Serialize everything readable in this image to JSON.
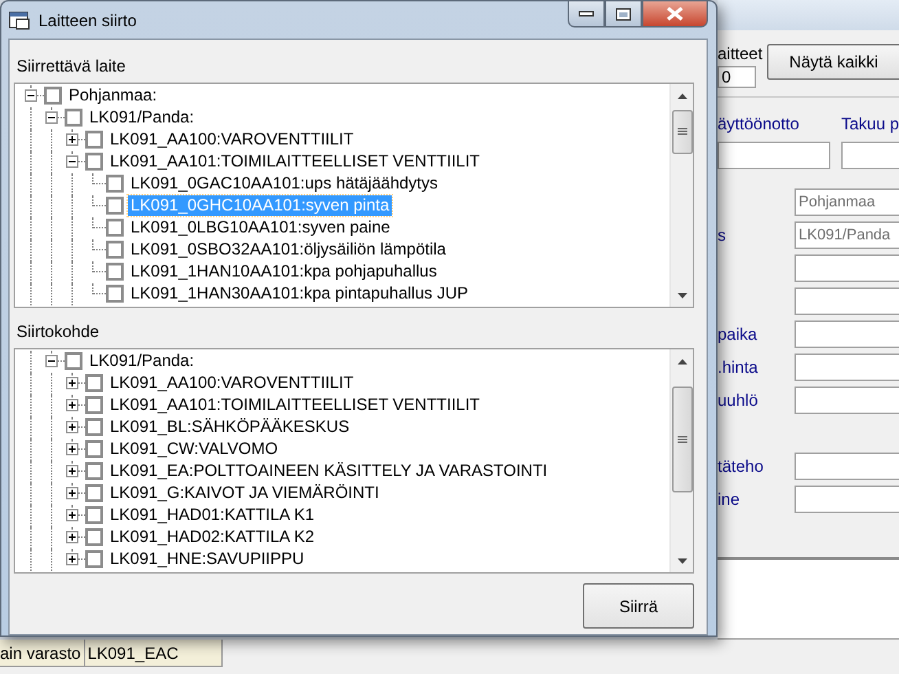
{
  "dialog": {
    "title": "Laitteen siirto",
    "source_label": "Siirrettävä laite",
    "source_tree": [
      {
        "label": "Pohjanmaa:",
        "checked": false,
        "selected": false,
        "expanded": true,
        "children": [
          {
            "label": "LK091/Panda:",
            "checked": false,
            "selected": false,
            "expanded": true,
            "children": [
              {
                "label": "LK091_AA100:VAROVENTTIILIT",
                "checked": false,
                "selected": false,
                "expanded": false
              },
              {
                "label": "LK091_AA101:TOIMILAITTEELLISET VENTTIILIT",
                "checked": false,
                "selected": false,
                "expanded": true,
                "children": [
                  {
                    "label": "LK091_0GAC10AA101:ups hätäjäähdytys",
                    "checked": false,
                    "selected": false
                  },
                  {
                    "label": "LK091_0GHC10AA101:syven pinta",
                    "checked": false,
                    "selected": true
                  },
                  {
                    "label": "LK091_0LBG10AA101:syven paine",
                    "checked": false,
                    "selected": false
                  },
                  {
                    "label": "LK091_0SBO32AA101:öljysäiliön lämpötila",
                    "checked": false,
                    "selected": false
                  },
                  {
                    "label": "LK091_1HAN10AA101:kpa pohjapuhallus",
                    "checked": false,
                    "selected": false
                  },
                  {
                    "label": "LK091_1HAN30AA101:kpa pintapuhallus JUP",
                    "checked": false,
                    "selected": false
                  }
                ]
              }
            ]
          }
        ]
      }
    ],
    "target_label": "Siirtokohde",
    "target_tree": [
      {
        "label": "LK091/Panda:",
        "checked": false,
        "selected": false,
        "expanded": true,
        "children": [
          {
            "label": "LK091_AA100:VAROVENTTIILIT",
            "checked": false,
            "selected": false,
            "expanded": false
          },
          {
            "label": "LK091_AA101:TOIMILAITTEELLISET VENTTIILIT",
            "checked": false,
            "selected": false,
            "expanded": false
          },
          {
            "label": "LK091_BL:SÄHKÖPÄÄKESKUS",
            "checked": false,
            "selected": false,
            "expanded": false
          },
          {
            "label": "LK091_CW:VALVOMO",
            "checked": false,
            "selected": false,
            "expanded": false
          },
          {
            "label": "LK091_EA:POLTTOAINEEN KÄSITTELY JA VARASTOINTI",
            "checked": false,
            "selected": false,
            "expanded": false
          },
          {
            "label": "LK091_G:KAIVOT JA VIEMÄRÖINTI",
            "checked": false,
            "selected": false,
            "expanded": false
          },
          {
            "label": "LK091_HAD01:KATTILA K1",
            "checked": false,
            "selected": false,
            "expanded": false
          },
          {
            "label": "LK091_HAD02:KATTILA K2",
            "checked": false,
            "selected": false,
            "expanded": false
          },
          {
            "label": "LK091_HNE:SAVUPIIPPU",
            "checked": false,
            "selected": false,
            "expanded": false
          }
        ]
      }
    ],
    "move_button": "Siirrä"
  },
  "background": {
    "devices_label": "aitteet",
    "device_count": "0",
    "show_all_button": "Näytä kaikki",
    "commissioning_label": "äyttöönotto",
    "warranty_label": "Takuu p",
    "form_rows": [
      {
        "value": "Pohjanmaa"
      },
      {
        "label": "s",
        "value": "LK091/Panda"
      },
      {},
      {},
      {
        "label": "paika"
      },
      {
        "label": ".hinta"
      },
      {
        "label": "uuhlö"
      }
    ],
    "form_rows_2": [
      {
        "label": "täteho"
      },
      {
        "label": "ine"
      }
    ],
    "table_rows": [
      {
        "column_1": "ain varasto",
        "column_2": "LK091_EAC"
      }
    ]
  }
}
